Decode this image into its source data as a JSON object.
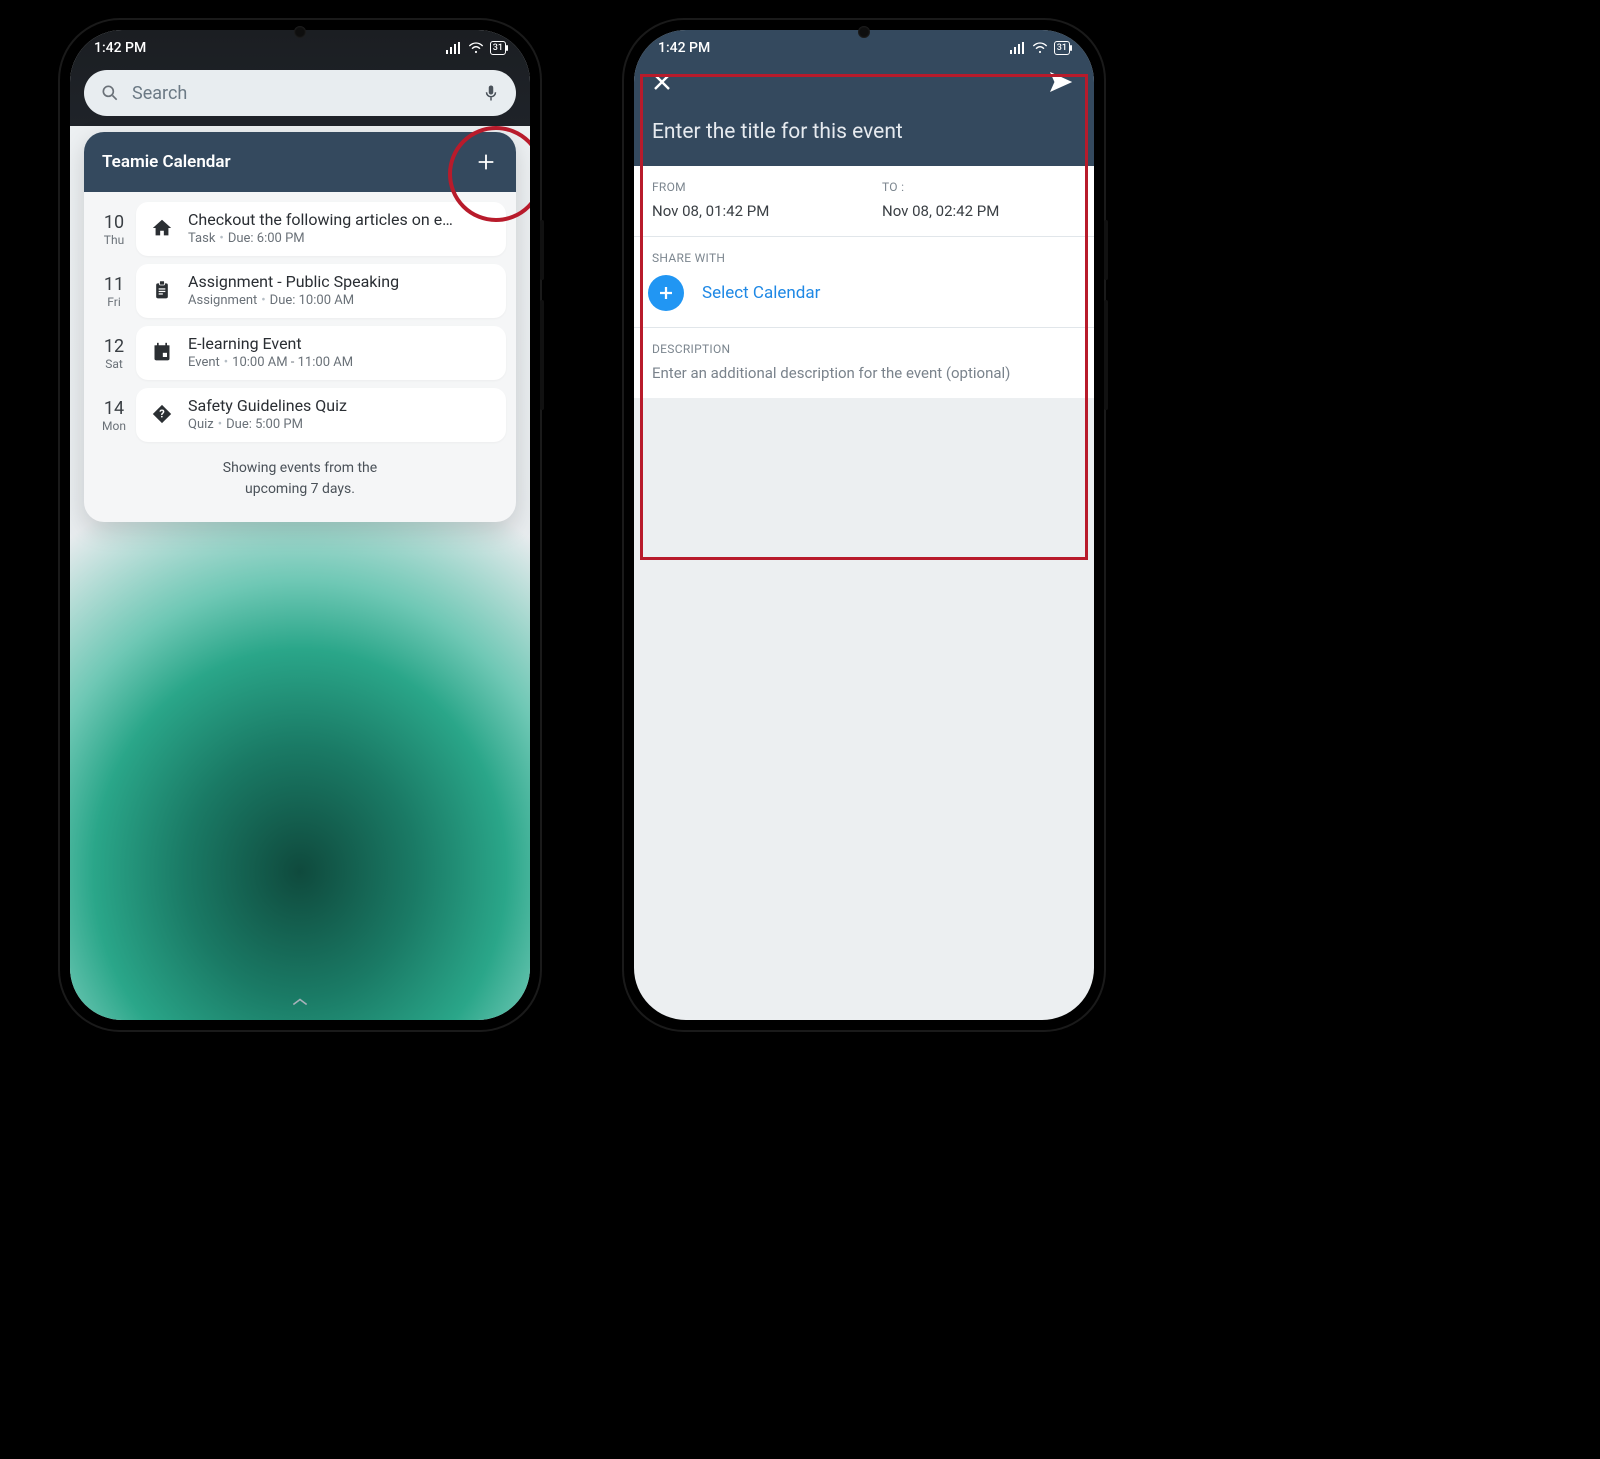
{
  "status": {
    "time": "1:42 PM",
    "battery": "31"
  },
  "phoneA": {
    "search_placeholder": "Search",
    "card_title": "Teamie Calendar",
    "events": [
      {
        "daynum": "10",
        "dayname": "Thu",
        "icon": "home",
        "title": "Checkout the following articles on e…",
        "type": "Task",
        "due": "Due: 6:00 PM"
      },
      {
        "daynum": "11",
        "dayname": "Fri",
        "icon": "clip",
        "title": "Assignment - Public Speaking",
        "type": "Assignment",
        "due": "Due: 10:00 AM"
      },
      {
        "daynum": "12",
        "dayname": "Sat",
        "icon": "event",
        "title": "E-learning Event",
        "type": "Event",
        "due": "10:00 AM - 11:00 AM"
      },
      {
        "daynum": "14",
        "dayname": "Mon",
        "icon": "quiz",
        "title": "Safety Guidelines Quiz",
        "type": "Quiz",
        "due": "Due: 5:00 PM"
      }
    ],
    "footer_l1": "Showing events from the",
    "footer_l2": "upcoming 7 days."
  },
  "phoneB": {
    "title_placeholder": "Enter the title for this event",
    "from_label": "FROM",
    "from_value": "Nov 08, 01:42 PM",
    "to_label": "TO :",
    "to_value": "Nov 08, 02:42 PM",
    "share_label": "SHARE WITH",
    "share_action": "Select Calendar",
    "desc_label": "DESCRIPTION",
    "desc_placeholder": "Enter an additional description for the event (optional)"
  }
}
